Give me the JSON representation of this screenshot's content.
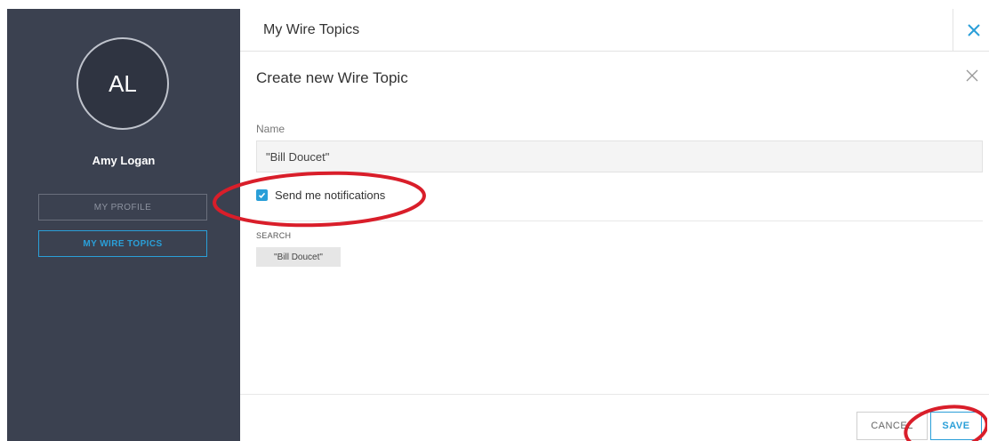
{
  "sidebar": {
    "avatar_initials": "AL",
    "user_name": "Amy Logan",
    "buttons": [
      {
        "label": "MY PROFILE"
      },
      {
        "label": "MY WIRE TOPICS"
      }
    ]
  },
  "header": {
    "title": "My Wire Topics"
  },
  "form": {
    "title": "Create new Wire Topic",
    "name_label": "Name",
    "name_value": "\"Bill Doucet\"",
    "notifications_label": "Send me notifications",
    "notifications_checked": true,
    "search_label": "SEARCH",
    "search_chip": "\"Bill Doucet\""
  },
  "footer": {
    "cancel_label": "CANCEL",
    "save_label": "SAVE"
  },
  "colors": {
    "sidebar_bg": "#3b4150",
    "accent": "#2a9fd8",
    "annotation_red": "#d91e2a"
  }
}
